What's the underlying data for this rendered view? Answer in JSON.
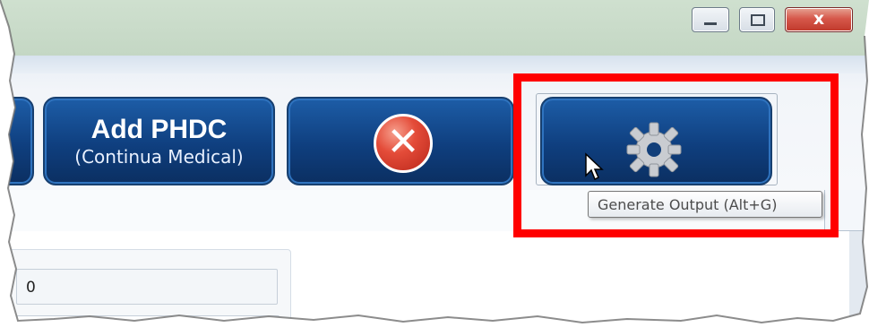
{
  "window": {
    "close_glyph": "x",
    "colors": {
      "accent": "#0f3f7f",
      "highlight": "#ff0000",
      "titlebar": "#c4d7c4"
    }
  },
  "toolbar": {
    "add_phdc": {
      "title": "Add PHDC",
      "subtitle": "(Continua Medical)"
    },
    "cancel": {
      "icon": "cancel-x-icon"
    },
    "generate_output": {
      "icon": "gear-icon",
      "tooltip": "Generate Output (Alt+G)"
    }
  },
  "form": {
    "field_value": "0"
  }
}
